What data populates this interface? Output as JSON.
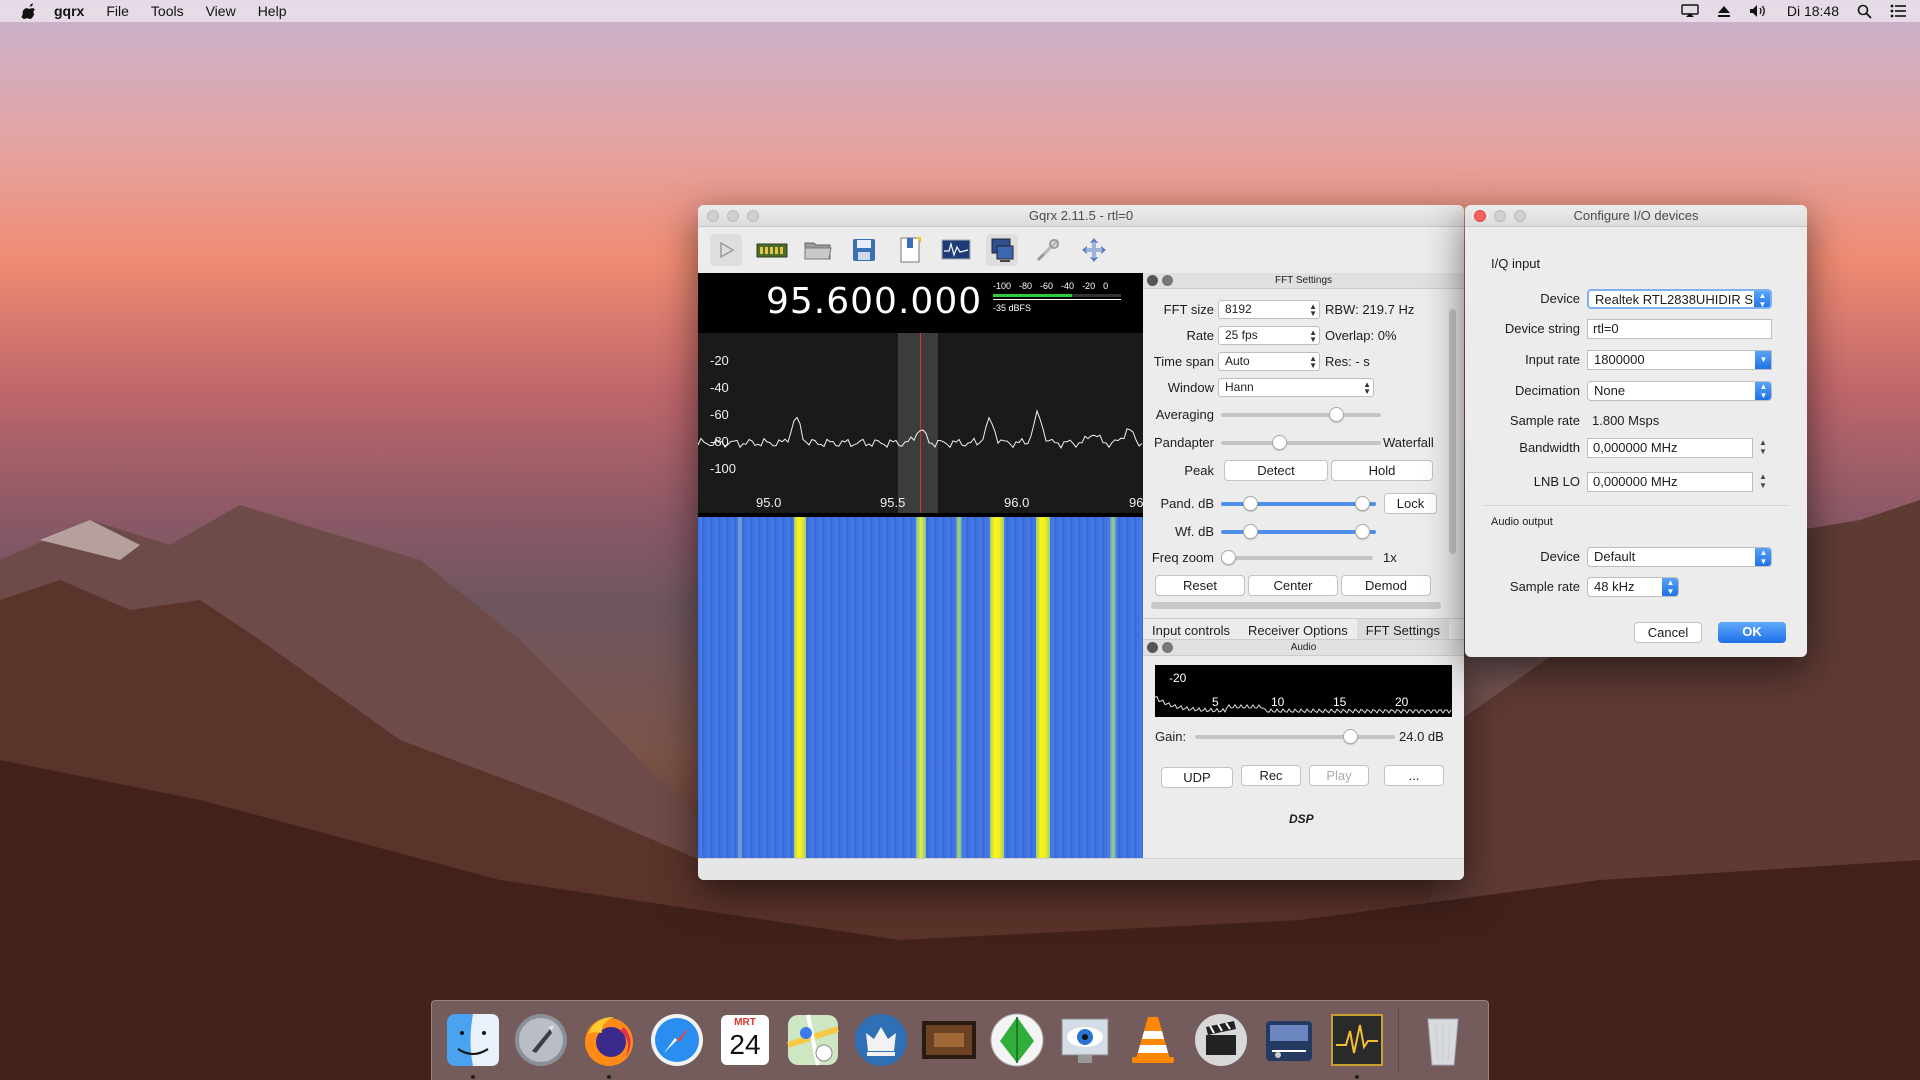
{
  "menubar": {
    "app_name": "gqrx",
    "items": [
      "File",
      "Tools",
      "View",
      "Help"
    ],
    "clock": "Di 18:48"
  },
  "gqrx_window": {
    "title": "Gqrx 2.11.5 - rtl=0",
    "frequency": "95.600.000",
    "smeter": {
      "scale": [
        "-100",
        "-80",
        "-60",
        "-40",
        "-20",
        "0"
      ],
      "reading": "-35 dBFS",
      "level": 0.62
    },
    "plot": {
      "y_ticks": [
        "-20",
        "-40",
        "-60",
        "-80",
        "-100"
      ],
      "x_ticks": [
        "95.0",
        "95.5",
        "96.0",
        "96"
      ]
    },
    "toolbar_icons": [
      "play-icon",
      "hardware-icon",
      "open-folder-icon",
      "save-icon",
      "bookmark-icon",
      "waveform-icon",
      "network-icon",
      "tools-icon",
      "fullscreen-icon"
    ]
  },
  "fft_settings": {
    "title": "FFT Settings",
    "fft_size_label": "FFT size",
    "fft_size": "8192",
    "rbw": "RBW: 219.7 Hz",
    "rate_label": "Rate",
    "rate": "25 fps",
    "overlap": "Overlap: 0%",
    "timespan_label": "Time span",
    "timespan": "Auto",
    "res": "Res: - s",
    "window_label": "Window",
    "window": "Hann",
    "averaging_label": "Averaging",
    "pandapter_label": "Pandapter",
    "waterfall_label": "Waterfall",
    "peak_label": "Peak",
    "detect": "Detect",
    "hold": "Hold",
    "pand_db_label": "Pand. dB",
    "lock": "Lock",
    "wf_db_label": "Wf. dB",
    "freq_zoom_label": "Freq zoom",
    "freq_zoom_value": "1x",
    "reset": "Reset",
    "center": "Center",
    "demod": "Demod"
  },
  "tabs": [
    "Input controls",
    "Receiver Options",
    "FFT Settings"
  ],
  "audio": {
    "title": "Audio",
    "spectrum_labels": [
      "-20",
      "5",
      "10",
      "15",
      "20"
    ],
    "gain_label": "Gain:",
    "gain_value": "24.0 dB",
    "udp": "UDP",
    "rec": "Rec",
    "play": "Play",
    "more": "...",
    "dsp": "DSP"
  },
  "config_dialog": {
    "title": "Configure I/O devices",
    "iq_section": "I/Q input",
    "device_label": "Device",
    "device": "Realtek RTL2838UHIDIR S",
    "device_string_label": "Device string",
    "device_string": "rtl=0",
    "input_rate_label": "Input rate",
    "input_rate": "1800000",
    "decimation_label": "Decimation",
    "decimation": "None",
    "sample_rate_label": "Sample rate",
    "sample_rate": "1.800 Msps",
    "bandwidth_label": "Bandwidth",
    "bandwidth": "0,000000 MHz",
    "lnb_lo_label": "LNB LO",
    "lnb_lo": "0,000000 MHz",
    "audio_section": "Audio output",
    "audio_device_label": "Device",
    "audio_device": "Default",
    "audio_rate_label": "Sample rate",
    "audio_rate": "48 kHz",
    "cancel": "Cancel",
    "ok": "OK"
  },
  "dock": {
    "icons": [
      "finder-icon",
      "launchpad-icon",
      "firefox-icon",
      "safari-icon",
      "calendar-icon",
      "maps-icon",
      "chess-icon",
      "movie-thumbnail-icon",
      "sdr-icon",
      "preview-icon",
      "vlc-icon",
      "clapper-icon",
      "radio-app-icon",
      "gqrx-icon",
      "trash-icon"
    ],
    "calendar_month": "MRT",
    "calendar_day": "24"
  },
  "colors": {
    "accent": "#1c6fe6",
    "waterfall_bg": "#3a6fe0",
    "signal": "#ffef1a"
  }
}
